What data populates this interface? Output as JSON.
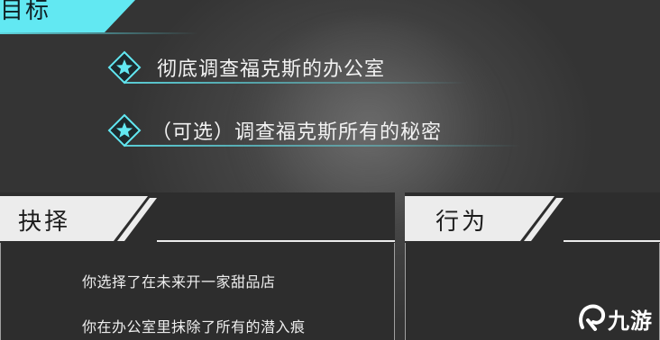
{
  "objectives": {
    "header": "目标",
    "items": [
      {
        "text": "彻底调查福克斯的办公室"
      },
      {
        "text": "（可选）调查福克斯所有的秘密"
      }
    ]
  },
  "choices_panel": {
    "title": "抉择",
    "lines": [
      "你选择了在未来开一家甜品店",
      "你在办公室里抹除了所有的潜入痕"
    ]
  },
  "actions_panel": {
    "title": "行为"
  },
  "watermark": {
    "text": "九游"
  },
  "colors": {
    "accent": "#62E8F2",
    "header_bg": "#ECECEC",
    "panel_body": "#2D2D2D"
  }
}
